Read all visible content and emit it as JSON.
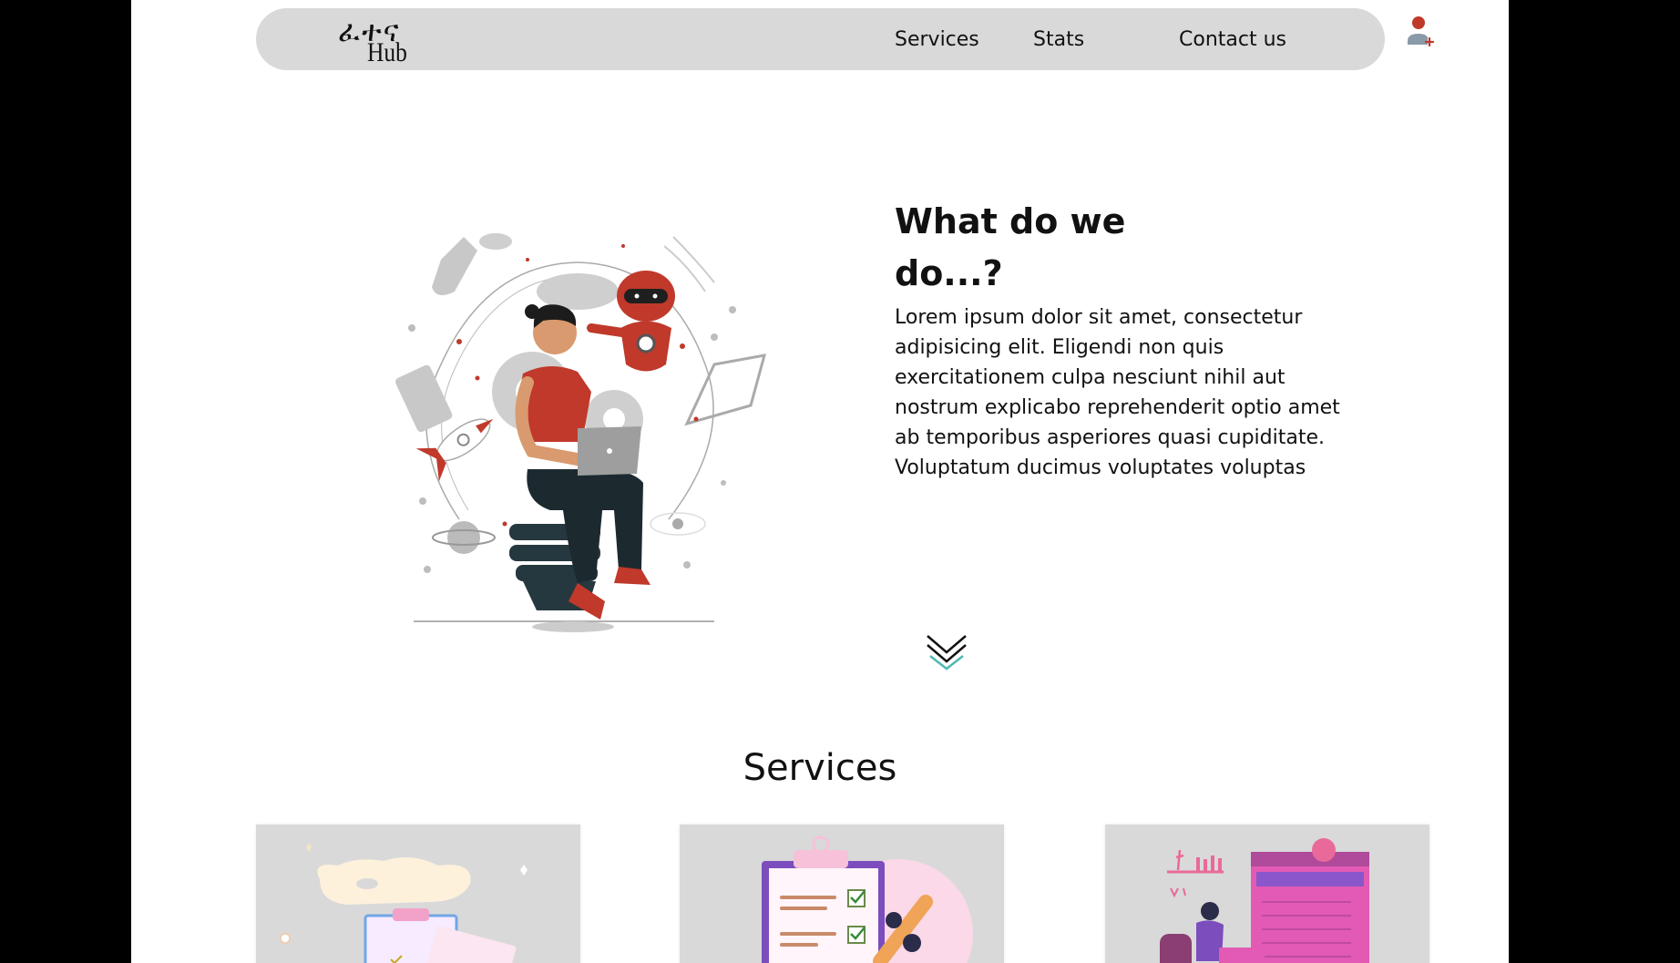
{
  "brand": {
    "logo_glyphs": "ፈተና",
    "logo_text": "Hub"
  },
  "nav": {
    "services": "Services",
    "stats": "Stats",
    "contact": "Contact us"
  },
  "hero": {
    "title": "What do we do...?",
    "body": "Lorem ipsum dolor sit amet, consectetur adipisicing elit. Eligendi non quis exercitationem culpa nesciunt nihil aut nostrum explicabo reprehenderit optio amet ab temporibus asperiores quasi cupiditate. Voluptatum ducimus voluptates voluptas"
  },
  "services": {
    "title": "Services"
  },
  "icons": {
    "user": "user-add-icon",
    "scroll": "chevron-double-down-icon"
  },
  "colors": {
    "accent_red": "#c0392b",
    "navbar_bg": "#d9d9d9",
    "card_bg": "#d9d9d9",
    "chevron_teal": "#4fb8b0",
    "purple_accent": "#7b4dbd",
    "pink_accent": "#e05aa7"
  }
}
